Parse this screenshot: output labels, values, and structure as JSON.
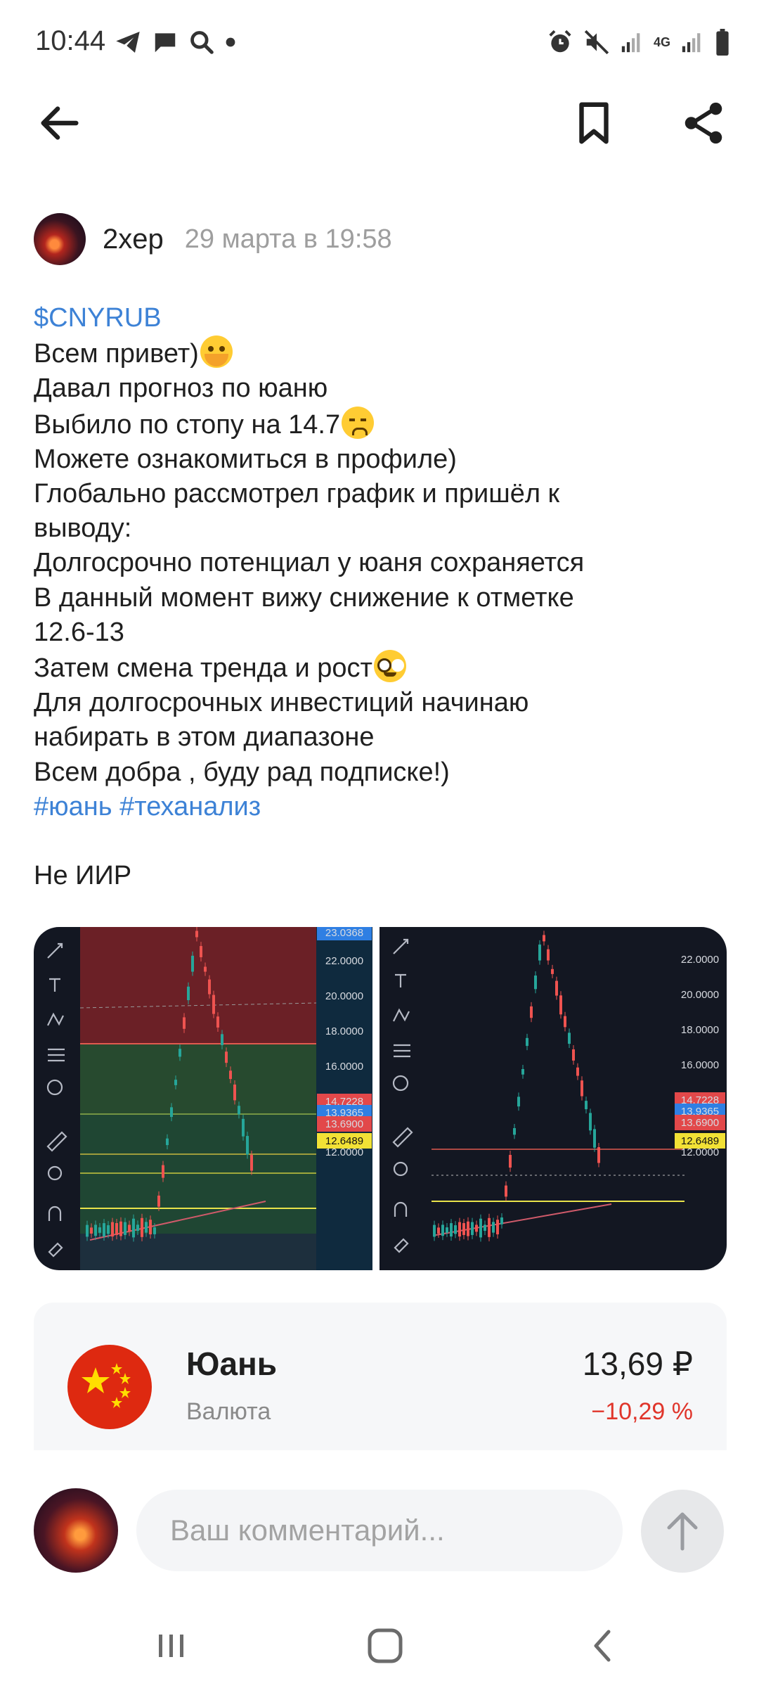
{
  "status_bar": {
    "time": "10:44",
    "left_icons": [
      "telegram-icon",
      "message-icon",
      "search-icon",
      "dot-icon"
    ],
    "right_icons": [
      "alarm-icon",
      "mute-icon",
      "signal-icon",
      "4g-icon",
      "signal-icon",
      "battery-icon"
    ],
    "network_label": "4G"
  },
  "top_bar": {
    "back_icon": "arrow-left-icon",
    "bookmark_icon": "bookmark-icon",
    "share_icon": "share-icon"
  },
  "post": {
    "author": "2xep",
    "date": "29 марта в 19:58",
    "ticker": "$CNYRUB",
    "lines": [
      "Всем привет)",
      "Давал прогноз по юаню",
      "Выбило по стопу на 14.7",
      "Можете ознакомиться в профиле)",
      "Глобально рассмотрел график и пришёл к",
      "выводу:",
      "Долгосрочно потенциал у юаня сохраняется",
      "В данный момент вижу снижение к отметке",
      "12.6-13",
      "Затем смена тренда и рост",
      "Для долгосрочных инвестиций начинаю",
      "набирать в этом диапазоне",
      "Всем добра , буду рад подписке!)"
    ],
    "emojis": [
      "hugging-face-emoji",
      "sad-sweat-face-emoji",
      "nerd-face-emoji"
    ],
    "hashtags": "#юань #теханализ",
    "footer_note": "Не ИИР"
  },
  "charts": [
    {
      "price_labels": [
        "23.0368",
        "22.0000",
        "20.0000",
        "18.0000",
        "16.0000",
        "14.7228",
        "13.9365",
        "13.6900",
        "12.6489",
        "12.0000"
      ],
      "badge_colors": {
        "red": "#e2484a",
        "blue": "#2f7fe3",
        "yellow": "#f2e135"
      }
    },
    {
      "price_labels": [
        "22.0000",
        "20.0000",
        "18.0000",
        "16.0000",
        "14.7228",
        "13.9365",
        "13.6900",
        "12.6489",
        "12.0000"
      ]
    }
  ],
  "chart_tools": [
    "draw-icon",
    "text-icon",
    "pattern-icon",
    "fib-icon",
    "emoji-icon",
    "ruler-icon",
    "zoom-icon",
    "magnet-icon",
    "lock-icon"
  ],
  "asset": {
    "name": "Юань",
    "type": "Валюта",
    "price": "13,69 ₽",
    "change": "−10,29 %",
    "change_color": "#e0352b",
    "flag_icon": "china-flag-icon"
  },
  "comment": {
    "placeholder": "Ваш комментарий...",
    "send_icon": "arrow-up-icon"
  },
  "nav": {
    "recents_icon": "recents-icon",
    "home_icon": "home-icon",
    "back_icon": "chevron-left-icon"
  }
}
